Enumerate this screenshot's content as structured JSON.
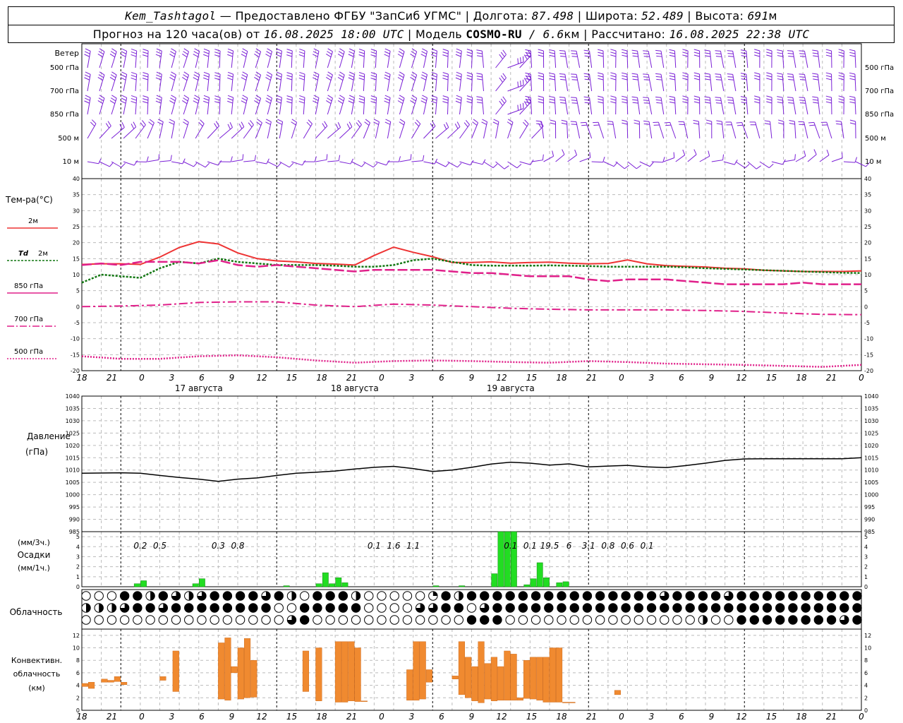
{
  "header": {
    "station": "Kem_Tashtagol",
    "provider": " — Предоставлено ФГБУ \"ЗапСиб УГМС\" | ",
    "lon_label": "Долгота: ",
    "lon_value": "87.498",
    "lat_label": " | Широта: ",
    "lat_value": "52.489",
    "alt_label": " | Высота: ",
    "alt_value": "691",
    "alt_unit": "м",
    "forecast_label": "Прогноз на 120 часа(ов) от ",
    "forecast_time": "16.08.2025 18:00 UTC",
    "model_label": " | Модель ",
    "model_name": "COSMO-RU",
    "model_res": " / 6.6",
    "model_unit": "км",
    "calc_label": " | Рассчитано: ",
    "calc_time": "16.08.2025 22:38 UTC"
  },
  "colors": {
    "wind": "#7a1fd6",
    "t2m": "#ee3333",
    "td2m": "#117711",
    "level_lines": "#e0208a",
    "pressure": "#000000",
    "precip": "#22dd22",
    "convective": "#f08a30"
  },
  "x_axis": {
    "hour_labels": [
      "18",
      "21",
      "0",
      "3",
      "6",
      "9",
      "12",
      "15",
      "18",
      "21",
      "0",
      "3",
      "6",
      "9",
      "12",
      "15",
      "18",
      "21",
      "0",
      "3",
      "6",
      "9",
      "12",
      "15",
      "18",
      "21",
      "0"
    ],
    "day_labels": [
      "17 августа",
      "18 августа",
      "19 августа"
    ]
  },
  "wind": {
    "title": "Ветер",
    "levels": [
      "500 гПа",
      "700 гПа",
      "850 гПа",
      "500 м",
      "10 м"
    ]
  },
  "temperature": {
    "title": "Тем-ра(°C)",
    "legend": {
      "t2m": "2м",
      "td_symbol": "Td",
      "td_level": "2м",
      "p850": "850 гПа",
      "p700": "700 гПа",
      "p500": "500 гПа"
    },
    "ticks": [
      "40",
      "35",
      "30",
      "25",
      "20",
      "15",
      "10",
      "5",
      "0",
      "-5",
      "-10",
      "-15",
      "-20"
    ]
  },
  "pressure": {
    "title": "Давление",
    "unit": "(гПа)",
    "ticks": [
      "1040",
      "1035",
      "1030",
      "1025",
      "1020",
      "1015",
      "1010",
      "1005",
      "1000",
      "995",
      "990",
      "985"
    ]
  },
  "precipitation": {
    "unit3h": "(мм/3ч.)",
    "title": "Осадки",
    "unit1h": "(мм/1ч.)",
    "ticks": [
      "5",
      "4",
      "3",
      "2",
      "1",
      "0"
    ],
    "totals": [
      {
        "hour": 9,
        "label": "0.2"
      },
      {
        "hour": 12,
        "label": "0.5"
      },
      {
        "hour": 21,
        "label": "0.3"
      },
      {
        "hour": 24,
        "label": "0.8"
      },
      {
        "hour": 45,
        "label": "0.1"
      },
      {
        "hour": 48,
        "label": "1.6"
      },
      {
        "hour": 51,
        "label": "1.1"
      },
      {
        "hour": 66,
        "label": "0.1"
      },
      {
        "hour": 69,
        "label": "0.1"
      },
      {
        "hour": 72,
        "label": "19.5"
      },
      {
        "hour": 75,
        "label": "6"
      },
      {
        "hour": 78,
        "label": "3.1"
      },
      {
        "hour": 81,
        "label": "0.8"
      },
      {
        "hour": 84,
        "label": "0.6"
      },
      {
        "hour": 87,
        "label": "0.1"
      }
    ]
  },
  "clouds": {
    "title": "Облачность"
  },
  "convective": {
    "title1": "Конвективн.",
    "title2": "облачность",
    "unit": "(км)",
    "ticks": [
      "12",
      "10",
      "8",
      "6",
      "4",
      "2",
      "0"
    ]
  },
  "chart_data": [
    {
      "type": "line",
      "title": "Тем-ра(°C)",
      "x_unit": "hours from 16.08.2025 18:00 UTC",
      "ylim": [
        -20,
        40
      ],
      "series": [
        {
          "name": "2м",
          "x": [
            0,
            3,
            6,
            9,
            12,
            15,
            18,
            21,
            24,
            27,
            30,
            33,
            36,
            39,
            42,
            45,
            48,
            51,
            54,
            57,
            60,
            63,
            66,
            69,
            72,
            75,
            78,
            81,
            84,
            87,
            90,
            93,
            96,
            99,
            102,
            105,
            108,
            111,
            114,
            117,
            120
          ],
          "values": [
            13.2,
            13.4,
            13.4,
            13.2,
            15.5,
            18.5,
            20.3,
            19.6,
            16.8,
            15.0,
            14.3,
            14.0,
            13.5,
            13.3,
            13.0,
            16.0,
            18.6,
            17.0,
            15.6,
            13.8,
            13.8,
            14.0,
            13.6,
            13.8,
            13.9,
            13.6,
            13.4,
            13.5,
            14.6,
            13.4,
            12.8,
            12.6,
            12.4,
            12.0,
            11.8,
            11.4,
            11.2,
            11.0,
            11.0,
            11.0,
            11.2
          ]
        },
        {
          "name": "2м",
          "x": [
            0,
            3,
            6,
            9,
            12,
            15,
            18,
            21,
            24,
            27,
            30,
            33,
            36,
            39,
            42,
            45,
            48,
            51,
            54,
            57,
            60,
            63,
            66,
            69,
            72,
            75,
            78,
            81,
            84,
            87,
            90,
            93,
            96,
            99,
            102,
            105,
            108,
            111,
            114,
            117,
            120
          ],
          "values": [
            7.5,
            10.0,
            9.5,
            9.0,
            12.0,
            14.0,
            13.5,
            15.0,
            14.0,
            13.5,
            13.0,
            13.0,
            13.0,
            12.8,
            12.5,
            12.5,
            13.0,
            14.5,
            15.0,
            14.0,
            13.0,
            12.8,
            12.8,
            12.8,
            12.9,
            12.8,
            12.7,
            12.5,
            12.5,
            12.5,
            12.5,
            12.3,
            12.0,
            11.8,
            11.6,
            11.4,
            11.2,
            11.0,
            10.8,
            10.6,
            10.5
          ]
        },
        {
          "name": "850 гПа",
          "x": [
            0,
            3,
            6,
            9,
            12,
            15,
            18,
            21,
            24,
            27,
            30,
            33,
            36,
            39,
            42,
            45,
            48,
            51,
            54,
            57,
            60,
            63,
            66,
            69,
            72,
            75,
            78,
            81,
            84,
            87,
            90,
            93,
            96,
            99,
            102,
            105,
            108,
            111,
            114,
            117,
            120
          ],
          "values": [
            13.0,
            13.5,
            13.0,
            14.0,
            14.0,
            14.0,
            13.5,
            14.5,
            13.0,
            12.5,
            13.0,
            12.5,
            12.0,
            11.5,
            11.0,
            11.5,
            11.5,
            11.5,
            11.5,
            11.0,
            10.5,
            10.5,
            10.0,
            9.5,
            9.5,
            9.5,
            8.5,
            8.0,
            8.5,
            8.5,
            8.5,
            8.0,
            7.5,
            7.0,
            7.0,
            7.0,
            7.0,
            7.5,
            7.0,
            7.0,
            7.0
          ]
        },
        {
          "name": "700 гПа",
          "x": [
            0,
            6,
            12,
            18,
            24,
            30,
            36,
            42,
            48,
            54,
            60,
            66,
            72,
            78,
            84,
            90,
            96,
            102,
            108,
            114,
            120
          ],
          "values": [
            0.0,
            0.2,
            0.5,
            1.3,
            1.5,
            1.5,
            0.5,
            0.0,
            0.8,
            0.5,
            0.0,
            -0.5,
            -0.8,
            -1.0,
            -1.0,
            -1.0,
            -1.2,
            -1.5,
            -2.0,
            -2.4,
            -2.5
          ]
        },
        {
          "name": "500 гПа",
          "x": [
            0,
            6,
            12,
            18,
            24,
            30,
            36,
            42,
            48,
            54,
            60,
            66,
            72,
            78,
            84,
            90,
            96,
            102,
            108,
            114,
            120
          ],
          "values": [
            -15.5,
            -16.3,
            -16.3,
            -15.5,
            -15.2,
            -15.8,
            -16.8,
            -17.5,
            -17.0,
            -16.8,
            -17.0,
            -17.3,
            -17.5,
            -17.0,
            -17.3,
            -17.8,
            -18.0,
            -18.2,
            -18.5,
            -18.8,
            -18.2
          ]
        }
      ]
    },
    {
      "type": "line",
      "title": "Давление",
      "x_unit": "hours from 16.08.2025 18:00 UTC",
      "ylim": [
        985,
        1040
      ],
      "series": [
        {
          "name": "Давление",
          "x": [
            0,
            6,
            9,
            12,
            15,
            18,
            21,
            24,
            27,
            30,
            33,
            36,
            39,
            42,
            45,
            48,
            51,
            54,
            57,
            60,
            63,
            66,
            69,
            72,
            75,
            78,
            81,
            84,
            87,
            90,
            93,
            96,
            99,
            102,
            105,
            108,
            111,
            114,
            117,
            120
          ],
          "values": [
            1008.7,
            1008.9,
            1008.7,
            1007.8,
            1007.0,
            1006.3,
            1005.4,
            1006.3,
            1006.8,
            1007.8,
            1008.7,
            1009.1,
            1009.6,
            1010.4,
            1011.1,
            1011.5,
            1010.6,
            1009.4,
            1010.0,
            1011.1,
            1012.4,
            1013.2,
            1012.8,
            1012.0,
            1012.5,
            1011.3,
            1011.6,
            1011.9,
            1011.3,
            1011.0,
            1011.8,
            1012.8,
            1013.9,
            1014.5,
            1014.6,
            1014.6,
            1014.6,
            1014.6,
            1014.6,
            1015.0
          ]
        }
      ]
    },
    {
      "type": "bar",
      "title": "Осадки",
      "x_unit": "hours from 16.08.2025 18:00 UTC",
      "ylim": [
        0,
        5.5
      ],
      "x": [
        8,
        9,
        17,
        18,
        31,
        36,
        37,
        38,
        39,
        40,
        54,
        58,
        63,
        64,
        65,
        66,
        68,
        69,
        70,
        71,
        73,
        74
      ],
      "values": [
        0.3,
        0.6,
        0.3,
        0.8,
        0.1,
        0.3,
        1.4,
        0.3,
        0.9,
        0.4,
        0.1,
        0.1,
        1.3,
        5.5,
        5.5,
        5.5,
        0.2,
        0.8,
        2.4,
        0.9,
        0.4,
        0.5
      ]
    },
    {
      "type": "bar",
      "title": "Конвективн. облачность",
      "x_unit": "hours from 16.08.2025 18:00 UTC",
      "y_unit": "км",
      "ylim": [
        0,
        13
      ],
      "x": [
        0,
        1,
        3,
        4,
        5,
        6,
        12,
        14,
        21,
        22,
        23,
        24,
        25,
        26,
        34,
        36,
        39,
        40,
        41,
        42,
        43,
        50,
        51,
        52,
        53,
        57,
        58,
        59,
        60,
        61,
        62,
        63,
        64,
        65,
        66,
        67,
        68,
        69,
        70,
        71,
        72,
        73,
        74,
        75,
        82
      ],
      "bottoms": [
        3.8,
        3.5,
        4.5,
        4.5,
        4.6,
        4.1,
        4.8,
        3.0,
        1.8,
        1.6,
        6.0,
        1.8,
        2.0,
        2.1,
        3.0,
        1.5,
        1.3,
        1.3,
        1.5,
        1.4,
        1.4,
        1.6,
        1.6,
        1.8,
        4.5,
        5.0,
        2.5,
        2.0,
        1.5,
        1.2,
        1.8,
        1.5,
        1.6,
        1.6,
        1.6,
        1.6,
        1.9,
        1.8,
        1.6,
        1.3,
        1.3,
        1.3,
        1.3,
        1.3,
        2.5
      ],
      "tops": [
        4.3,
        4.5,
        5.0,
        4.8,
        5.4,
        4.5,
        5.4,
        9.5,
        10.8,
        11.6,
        7.0,
        10.0,
        11.5,
        8.0,
        9.5,
        10.0,
        11.0,
        11.0,
        11.0,
        10.0,
        1.5,
        6.5,
        11.0,
        11.0,
        6.5,
        5.5,
        11.0,
        8.5,
        7.0,
        11.0,
        7.5,
        8.5,
        7.0,
        9.5,
        9.0,
        2.0,
        8.0,
        8.5,
        8.5,
        8.5,
        10.0,
        10.0,
        1.3,
        1.3,
        3.2
      ]
    }
  ]
}
